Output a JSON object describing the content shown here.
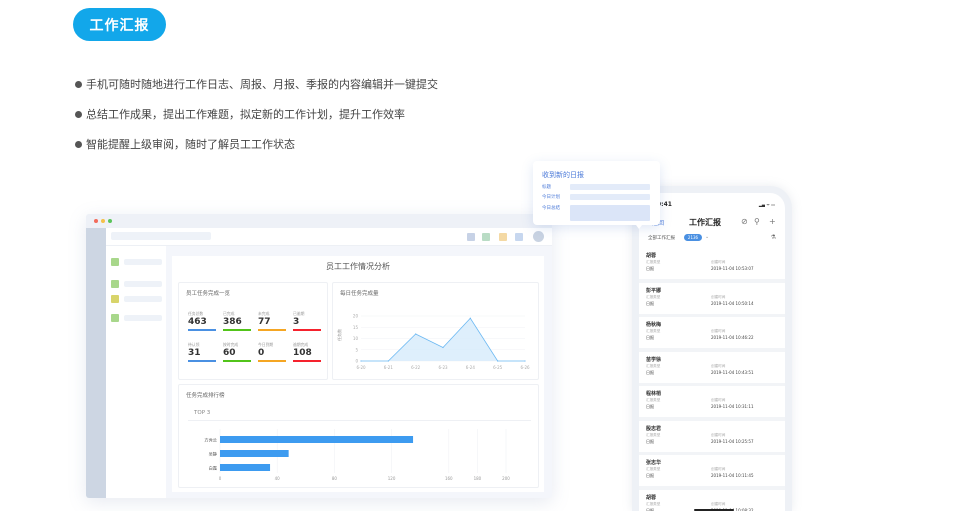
{
  "badge": {
    "label": "工作汇报"
  },
  "bullets": [
    "手机可随时随地进行工作日志、周报、月报、季报的内容编辑并一键提交",
    "总结工作成果，提出工作难题，拟定新的工作计划，提升工作效率",
    "智能提醒上级审阅，随时了解员工工作状态"
  ],
  "colors": {
    "accent": "#12a7ea",
    "chart_blue": "#3d9bf0",
    "nav_green": "#a8d78b",
    "nav_yellow": "#d8d46a"
  },
  "desktop": {
    "main_title": "员工工作情况分析",
    "card1": {
      "title": "员工任务完成一览",
      "stats": [
        {
          "label": "任务总数",
          "value": "463",
          "color": "#4a90e2"
        },
        {
          "label": "已完成",
          "value": "386",
          "color": "#52c41a"
        },
        {
          "label": "未完成",
          "value": "77",
          "color": "#f5a623"
        },
        {
          "label": "已逾期",
          "value": "3",
          "color": "#f5222d"
        },
        {
          "label": "待认领",
          "value": "31",
          "color": "#4a90e2"
        },
        {
          "label": "按时完成",
          "value": "60",
          "color": "#52c41a"
        },
        {
          "label": "今日到期",
          "value": "0",
          "color": "#f5a623"
        },
        {
          "label": "逾期完成",
          "value": "108",
          "color": "#f5222d"
        }
      ]
    },
    "card2": {
      "title": "每日任务完成量",
      "ylabel": "任务数"
    },
    "card3": {
      "title": "任务完成排行榜",
      "tab": "TOP 3"
    }
  },
  "chart_data": [
    {
      "type": "area",
      "title": "每日任务完成量",
      "ylabel": "任务数",
      "x": [
        "6-20",
        "6-21",
        "6-22",
        "6-23",
        "6-24",
        "6-25",
        "6-26"
      ],
      "values": [
        0,
        0,
        12,
        6,
        19,
        0,
        0
      ],
      "ylim": [
        0,
        20
      ],
      "yticks": [
        0,
        5,
        10,
        15,
        20
      ]
    },
    {
      "type": "bar",
      "orientation": "horizontal",
      "title": "任务完成排行榜",
      "categories": [
        "方秀兰",
        "吴静",
        "白霞"
      ],
      "values": [
        135,
        48,
        35
      ],
      "xlim": [
        0,
        200
      ],
      "xticks": [
        0,
        40,
        80,
        120,
        160,
        180,
        200
      ]
    }
  ],
  "bubble": {
    "title": "收到新的日报",
    "labels": [
      "标题",
      "今日计划",
      "今日总结"
    ]
  },
  "phone": {
    "time": "9:41",
    "status": "▂▄ ᯤ ▭",
    "back": "返回",
    "title": "工作汇报",
    "filter_label": "全部工作汇报",
    "filter_count": "2136",
    "chevron": "⌄",
    "icons": {
      "compass": "⊘",
      "search": "⚲",
      "add": "+",
      "filter": "⚗"
    },
    "field1_label": "汇报类型",
    "field2_label": "创建时间",
    "items": [
      {
        "name": "胡蓉",
        "type": "日报",
        "time": "2019-11-04 10:53:07"
      },
      {
        "name": "彭平娜",
        "type": "日报",
        "time": "2019-11-04 10:50:14"
      },
      {
        "name": "杨秋梅",
        "type": "日报",
        "time": "2019-11-04 10:46:22"
      },
      {
        "name": "苗学徐",
        "type": "日报",
        "time": "2019-11-04 10:43:51"
      },
      {
        "name": "程林梢",
        "type": "日报",
        "time": "2019-11-04 10:31:11"
      },
      {
        "name": "殷志君",
        "type": "日报",
        "time": "2019-11-04 10:25:57"
      },
      {
        "name": "张志华",
        "type": "日报",
        "time": "2019-11-04 10:11:45"
      },
      {
        "name": "胡蓉",
        "type": "日报",
        "time": "2019-11-04 10:08:32"
      }
    ]
  }
}
